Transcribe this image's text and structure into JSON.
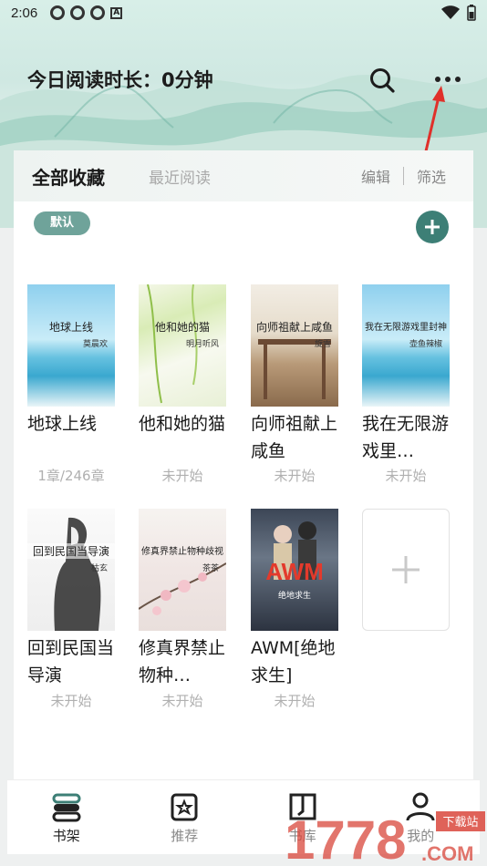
{
  "status_bar": {
    "time": "2:06",
    "right_icons": [
      "wifi-icon",
      "battery-icon"
    ]
  },
  "header": {
    "reading_time": "今日阅读时长：0分钟",
    "icons": [
      "search-icon",
      "more-icon"
    ]
  },
  "tabs": {
    "all": "全部收藏",
    "recent": "最近阅读",
    "edit": "编辑",
    "filter": "筛选"
  },
  "group_pill": "默认",
  "books": [
    {
      "title": "地球上线",
      "progress": "1章/246章",
      "cover_title": "地球上线",
      "cover_author": "莫晨欢",
      "cover_style": "sea"
    },
    {
      "title": "他和她的猫",
      "progress": "未开始",
      "cover_title": "他和她的猫",
      "cover_author": "明月听风",
      "cover_style": "willow"
    },
    {
      "title": "向师祖献上咸鱼",
      "progress": "未开始",
      "cover_title": "向师祖献上咸鱼",
      "cover_author": "旋雪",
      "cover_style": "pavilion"
    },
    {
      "title": "我在无限游戏里…",
      "progress": "未开始",
      "cover_title": "我在无限游戏里封神",
      "cover_author": "壶鱼辣椒",
      "cover_style": "sea"
    },
    {
      "title": "回到民国当导演",
      "progress": "未开始",
      "cover_title": "回到民国当导演",
      "cover_author": "枯玄",
      "cover_style": "sketch"
    },
    {
      "title": "修真界禁止物种…",
      "progress": "未开始",
      "cover_title": "修真界禁止物种歧视",
      "cover_author": "茶茶",
      "cover_style": "blossom"
    },
    {
      "title": "AWM[绝地求生]",
      "progress": "未开始",
      "cover_title": "AWM",
      "cover_author": "绝地求生",
      "cover_style": "awm"
    }
  ],
  "bottom_nav": [
    {
      "label": "书架",
      "icon": "bookshelf-icon",
      "active": true
    },
    {
      "label": "推荐",
      "icon": "recommend-icon",
      "active": false
    },
    {
      "label": "书库",
      "icon": "library-icon",
      "active": false
    },
    {
      "label": "我的",
      "icon": "profile-icon",
      "active": false
    }
  ],
  "watermark": {
    "text": "1778.COM",
    "badge": "下载站"
  },
  "colors": {
    "accent": "#3d7f76",
    "pill": "#6fa39a",
    "arrow": "#e0302a"
  }
}
